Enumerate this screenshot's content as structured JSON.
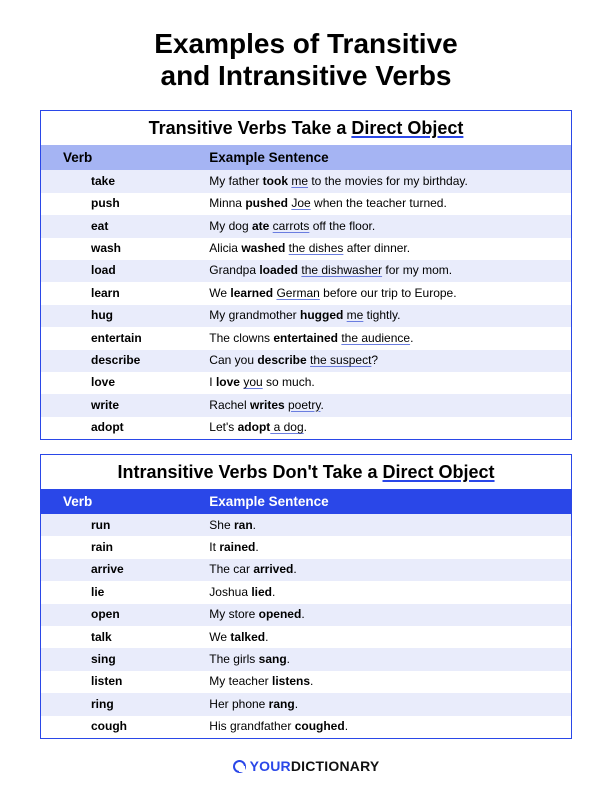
{
  "title_line1": "Examples of Transitive",
  "title_line2": "and Intransitive Verbs",
  "columns": {
    "verb": "Verb",
    "example": "Example Sentence"
  },
  "transitive": {
    "heading_prefix": "Transitive Verbs Take a ",
    "heading_underlined": "Direct Object",
    "rows": [
      {
        "verb": "take",
        "pre": "My father ",
        "bold": "took ",
        "obj": "me",
        "post": " to the movies for my birthday."
      },
      {
        "verb": "push",
        "pre": "Minna ",
        "bold": "pushed ",
        "obj": "Joe",
        "post": " when the teacher turned."
      },
      {
        "verb": "eat",
        "pre": "My dog ",
        "bold": "ate ",
        "obj": "carrots",
        "post": " off the floor."
      },
      {
        "verb": "wash",
        "pre": "Alicia ",
        "bold": "washed ",
        "obj": "the dishes",
        "post": " after dinner."
      },
      {
        "verb": "load",
        "pre": "Grandpa ",
        "bold": "loaded ",
        "obj": "the dishwasher",
        "post": " for my mom."
      },
      {
        "verb": "learn",
        "pre": "We ",
        "bold": "learned ",
        "obj": "German",
        "post": " before our trip to Europe."
      },
      {
        "verb": "hug",
        "pre": "My grandmother ",
        "bold": "hugged ",
        "obj": "me",
        "post": " tightly."
      },
      {
        "verb": "entertain",
        "pre": "The clowns ",
        "bold": "entertained ",
        "obj": "the audience",
        "post": "."
      },
      {
        "verb": "describe",
        "pre": "Can you ",
        "bold": "describe ",
        "obj": "the suspect",
        "post": "?"
      },
      {
        "verb": "love",
        "pre": "I ",
        "bold": "love ",
        "obj": "you",
        "post": " so much."
      },
      {
        "verb": "write",
        "pre": "Rachel ",
        "bold": "writes ",
        "obj": "poetry",
        "post": "."
      },
      {
        "verb": "adopt",
        "pre": "Let's ",
        "bold": "adopt",
        "obj": " a dog",
        "post": "."
      }
    ]
  },
  "intransitive": {
    "heading_prefix": "Intransitive Verbs Don't Take a ",
    "heading_underlined": "Direct Object",
    "rows": [
      {
        "verb": "run",
        "pre": "She ",
        "bold": "ran",
        "post": "."
      },
      {
        "verb": "rain",
        "pre": "It ",
        "bold": "rained",
        "post": "."
      },
      {
        "verb": "arrive",
        "pre": "The car ",
        "bold": "arrived",
        "post": "."
      },
      {
        "verb": "lie",
        "pre": "Joshua ",
        "bold": "lied",
        "post": "."
      },
      {
        "verb": "open",
        "pre": "My store ",
        "bold": "opened",
        "post": "."
      },
      {
        "verb": "talk",
        "pre": "We ",
        "bold": "talked",
        "post": "."
      },
      {
        "verb": "sing",
        "pre": "The girls ",
        "bold": "sang",
        "post": "."
      },
      {
        "verb": "listen",
        "pre": "My teacher ",
        "bold": "listens",
        "post": "."
      },
      {
        "verb": "ring",
        "pre": "Her phone ",
        "bold": "rang",
        "post": "."
      },
      {
        "verb": "cough",
        "pre": "His grandfather ",
        "bold": "coughed",
        "post": "."
      }
    ]
  },
  "footer": {
    "brand_your": "YOUR",
    "brand_dict": "DICTIONARY"
  }
}
